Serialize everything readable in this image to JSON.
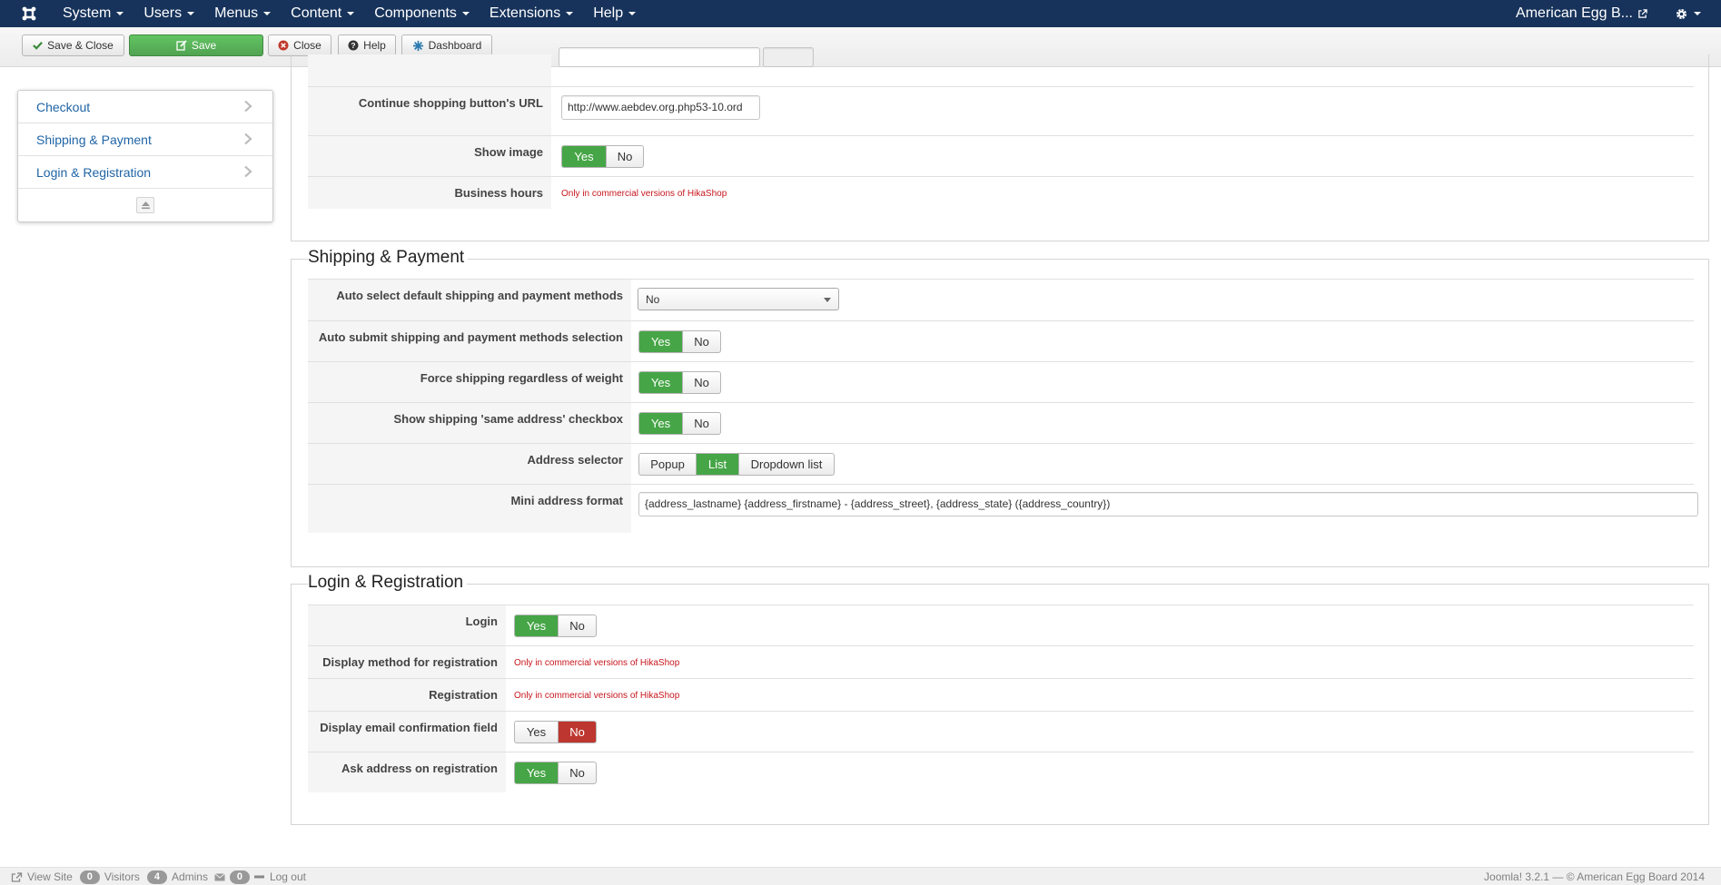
{
  "nav": {
    "menu": [
      "System",
      "Users",
      "Menus",
      "Content",
      "Components",
      "Extensions",
      "Help"
    ],
    "site_name": "American Egg B...",
    "icons": {
      "logo": "joomla-logo-icon",
      "external": "external-link-icon",
      "settings": "gear-icon"
    }
  },
  "toolbar": {
    "save_close": "Save & Close",
    "save": "Save",
    "close": "Close",
    "help": "Help",
    "dashboard": "Dashboard"
  },
  "sidebar": {
    "items": [
      {
        "label": "Checkout"
      },
      {
        "label": "Shipping & Payment"
      },
      {
        "label": "Login & Registration"
      }
    ]
  },
  "checkout": {
    "rows": [
      {
        "label": "Continue shopping button's URL",
        "value": "http://www.aebdev.org.php53-10.ord"
      },
      {
        "label": "Show image",
        "yes": "Yes",
        "no": "No",
        "selected": "Yes"
      },
      {
        "label": "Business hours",
        "note": "Only in commercial versions of HikaShop"
      }
    ]
  },
  "shipping": {
    "legend": "Shipping & Payment",
    "rows": [
      {
        "label": "Auto select default shipping and payment methods",
        "value": "No"
      },
      {
        "label": "Auto submit shipping and payment methods selection",
        "yes": "Yes",
        "no": "No",
        "selected": "Yes"
      },
      {
        "label": "Force shipping regardless of weight",
        "yes": "Yes",
        "no": "No",
        "selected": "Yes"
      },
      {
        "label": "Show shipping 'same address' checkbox",
        "yes": "Yes",
        "no": "No",
        "selected": "Yes"
      },
      {
        "label": "Address selector",
        "options": [
          "Popup",
          "List",
          "Dropdown list"
        ],
        "selected": "List"
      },
      {
        "label": "Mini address format",
        "value": "{address_lastname} {address_firstname} - {address_street}, {address_state} ({address_country})"
      }
    ]
  },
  "login": {
    "legend": "Login & Registration",
    "rows": [
      {
        "label": "Login",
        "yes": "Yes",
        "no": "No",
        "selected": "Yes"
      },
      {
        "label": "Display method for registration",
        "note": "Only in commercial versions of HikaShop"
      },
      {
        "label": "Registration",
        "note": "Only in commercial versions of HikaShop"
      },
      {
        "label": "Display email confirmation field",
        "yes": "Yes",
        "no": "No",
        "selected": "No"
      },
      {
        "label": "Ask address on registration",
        "yes": "Yes",
        "no": "No",
        "selected": "Yes"
      }
    ]
  },
  "status": {
    "view_site": "View Site",
    "visitors_count": "0",
    "visitors": "Visitors",
    "admins_count": "4",
    "admins": "Admins",
    "messages_count": "0",
    "logout": "Log out",
    "version": "Joomla! 3.2.1 — © American Egg Board 2014"
  },
  "colors": {
    "navbar": "#17335b",
    "success": "#46a546",
    "danger": "#bd362f",
    "link": "#1f64a6",
    "note": "#c7161d"
  }
}
